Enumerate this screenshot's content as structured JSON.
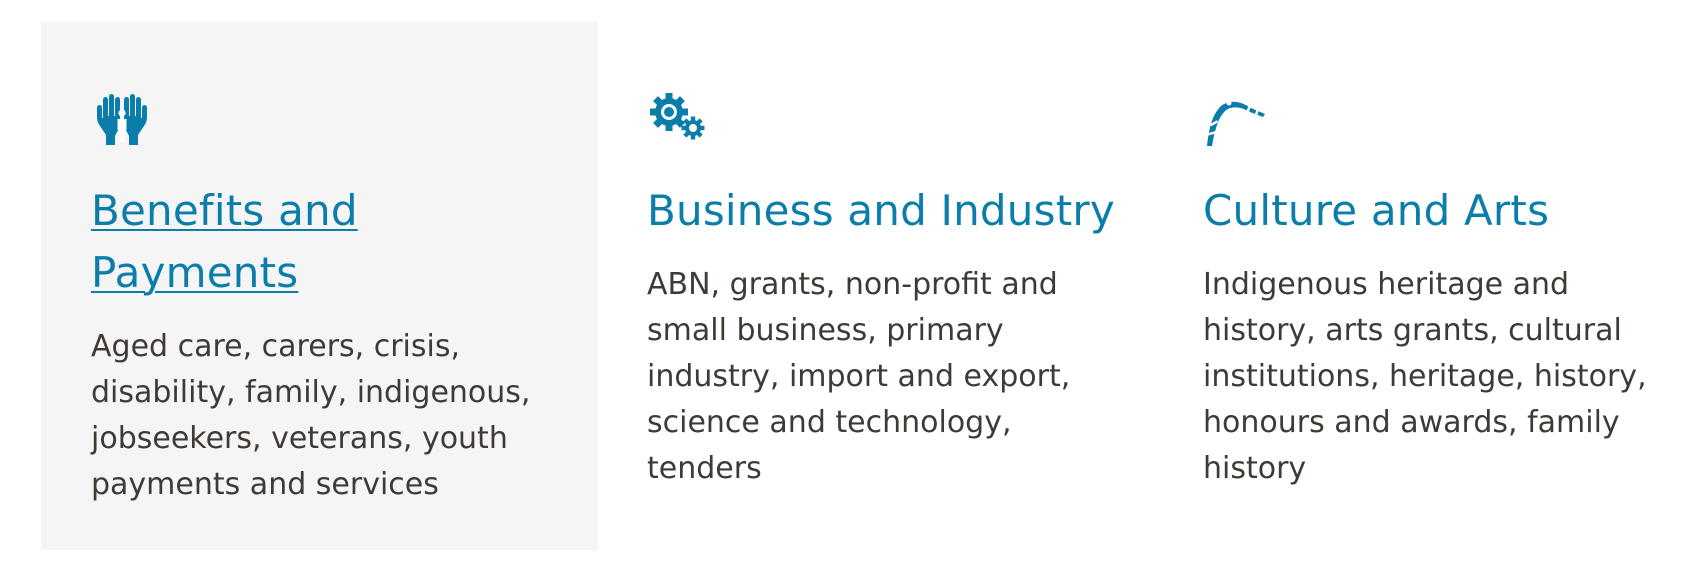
{
  "accent_color": "#0b7dab",
  "cards": [
    {
      "icon": "hands-family-icon",
      "title": "Benefits and Payments",
      "description": "Aged care, carers, crisis, disability, family, indigenous, jobseekers, veterans, youth payments and services",
      "highlighted": true
    },
    {
      "icon": "gears-icon",
      "title": "Business and Industry",
      "description": "ABN, grants, non-profit and small business, primary industry, import and export, science and technology, tenders",
      "highlighted": false
    },
    {
      "icon": "boomerang-icon",
      "title": "Culture and Arts",
      "description": "Indigenous heritage and history, arts grants, cultural institutions, heritage, history, honours and awards, family history",
      "highlighted": false
    }
  ]
}
